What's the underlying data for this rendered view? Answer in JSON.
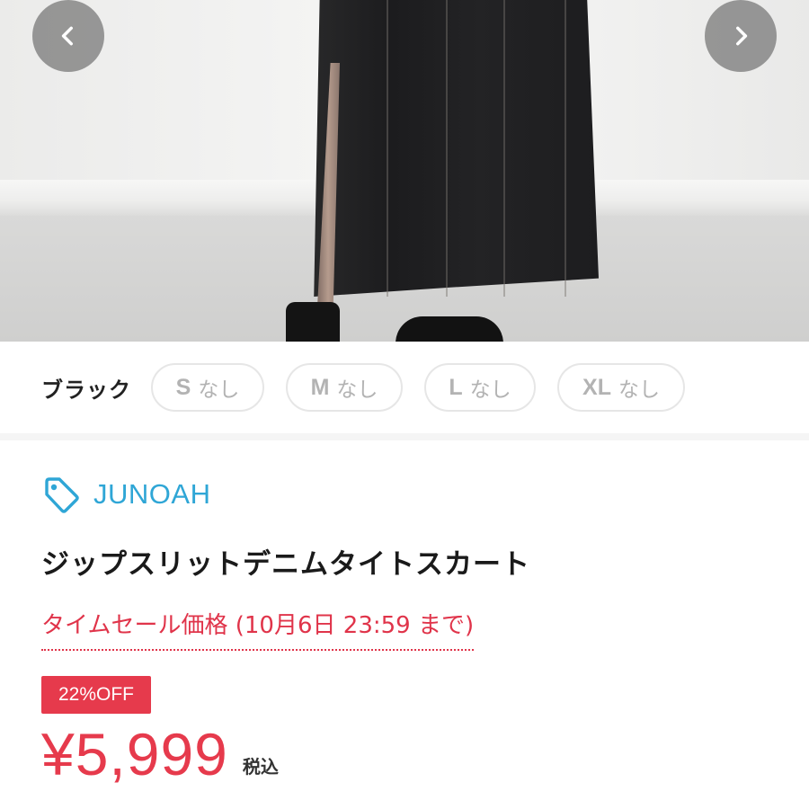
{
  "carousel": {
    "prev_icon": "chevron-left-icon",
    "next_icon": "chevron-right-icon"
  },
  "variants": {
    "color": "ブラック",
    "sizes": [
      {
        "size": "S",
        "status": "なし"
      },
      {
        "size": "M",
        "status": "なし"
      },
      {
        "size": "L",
        "status": "なし"
      },
      {
        "size": "XL",
        "status": "なし"
      }
    ],
    "chip_text_color": "#b3b3b3"
  },
  "product": {
    "brand": "JUNOAH",
    "brand_icon": "tag-icon",
    "brand_color": "#2fa6d6",
    "title": "ジップスリットデニムタイトスカート",
    "sale_note": "タイムセール価格 (10月6日 23:59 まで)",
    "discount_badge": "22%OFF",
    "price": "¥5,999",
    "tax_label": "税込",
    "accent_color": "#e63a4c"
  }
}
